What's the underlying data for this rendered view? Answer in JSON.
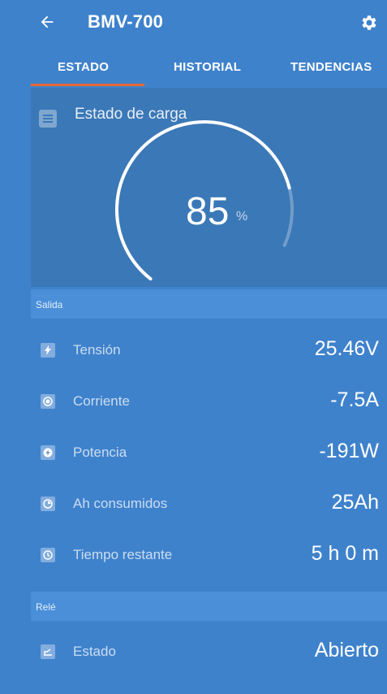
{
  "header": {
    "title": "BMV-700",
    "back_icon": "arrow-left-icon",
    "settings_icon": "gear-icon"
  },
  "tabs": [
    {
      "label": "ESTADO",
      "active": true
    },
    {
      "label": "HISTORIAL",
      "active": false
    },
    {
      "label": "TENDENCIAS",
      "active": false
    }
  ],
  "state_of_charge": {
    "title": "Estado de carga",
    "value": "85",
    "unit": "%",
    "percent": 85,
    "icon": "battery-list-icon"
  },
  "output": {
    "section_label": "Salida",
    "rows": [
      {
        "label": "Tensión",
        "value": "25.46V",
        "icon": "bolt-icon"
      },
      {
        "label": "Corriente",
        "value": "-7.5A",
        "icon": "current-icon"
      },
      {
        "label": "Potencia",
        "value": "-191W",
        "icon": "power-icon"
      },
      {
        "label": "Ah consumidos",
        "value": "25Ah",
        "icon": "consumed-ah-icon"
      },
      {
        "label": "Tiempo restante",
        "value": "5 h 0 m",
        "icon": "clock-icon"
      }
    ]
  },
  "relay": {
    "section_label": "Relé",
    "rows": [
      {
        "label": "Estado",
        "value": "Abierto",
        "icon": "relay-icon"
      }
    ]
  },
  "colors": {
    "background": "#3f82cc",
    "gauge_panel": "#3b78b7",
    "section_header": "#4a8fd8",
    "tab_indicator": "#e66a33"
  }
}
